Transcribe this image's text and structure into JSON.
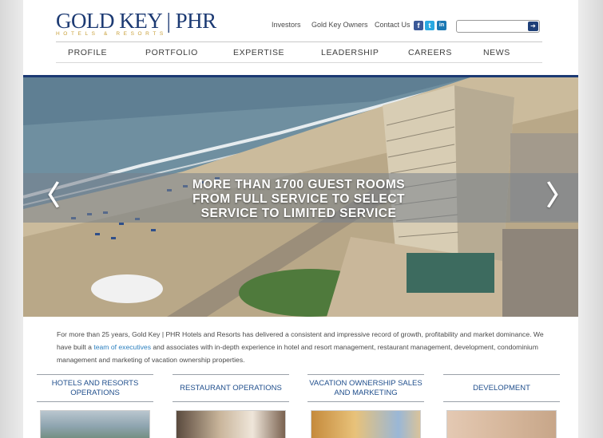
{
  "brand": {
    "name": "GOLD KEY | PHR",
    "tagline": "HOTELS & RESORTS"
  },
  "toplinks": [
    "Investors",
    "Gold Key Owners",
    "Contact Us"
  ],
  "social": [
    {
      "name": "facebook",
      "glyph": "f",
      "color": "#3b5998"
    },
    {
      "name": "twitter",
      "glyph": "t",
      "color": "#29a9e1"
    },
    {
      "name": "linkedin",
      "glyph": "in",
      "color": "#1b78b3"
    }
  ],
  "search": {
    "placeholder": "",
    "button_glyph": "➔"
  },
  "nav": [
    "PROFILE",
    "PORTFOLIO",
    "EXPERTISE",
    "LEADERSHIP",
    "CAREERS",
    "NEWS"
  ],
  "hero": {
    "caption": [
      "MORE THAN 1700 GUEST ROOMS",
      "FROM FULL SERVICE TO SELECT",
      "SERVICE TO LIMITED SERVICE"
    ],
    "prev": "〈",
    "next": "〉",
    "accent": "#1c3a73"
  },
  "intro": {
    "before_link": "For more than 25 years, Gold Key | PHR Hotels and Resorts has delivered a consistent and impressive record of growth, profitability and market dominance. We have built a ",
    "link": "team of executives",
    "after_link": " and associates with in-depth experience in hotel and resort management, restaurant management, development, condominium management and marketing of vacation ownership properties."
  },
  "columns": [
    {
      "title": "HOTELS AND RESORTS OPERATIONS"
    },
    {
      "title": "RESTAURANT OPERATIONS"
    },
    {
      "title": "VACATION OWNERSHIP SALES AND MARKETING"
    },
    {
      "title": "DEVELOPMENT"
    }
  ]
}
